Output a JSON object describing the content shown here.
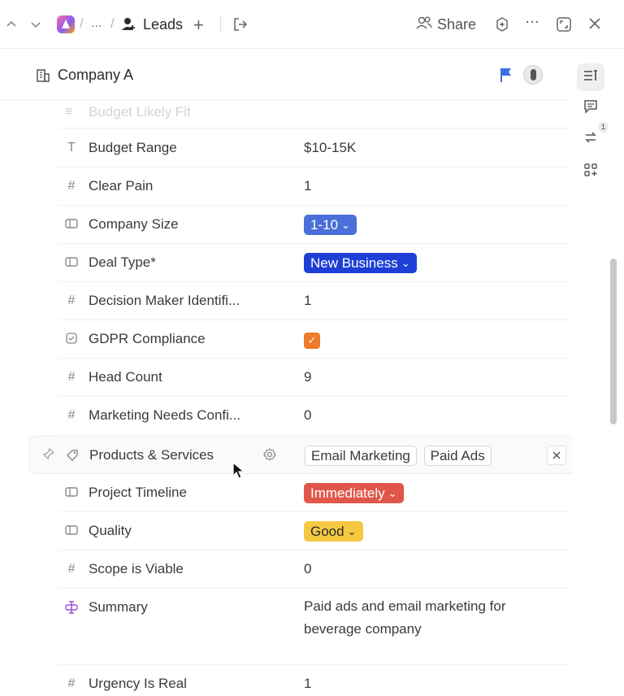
{
  "topbar": {
    "breadcrumb_ellipsis": "...",
    "breadcrumb_sep": "/",
    "list_name": "Leads",
    "share_label": "Share"
  },
  "record": {
    "title": "Company A",
    "flag_color": "#3b6fe0"
  },
  "fields": {
    "faded_above": "Budget Likely Fit",
    "rows": [
      {
        "name": "Budget Range",
        "icon": "text-icon",
        "value": "$10-15K"
      },
      {
        "name": "Clear Pain",
        "icon": "number-icon",
        "value": "1"
      },
      {
        "name": "Company Size",
        "icon": "dropdown-icon",
        "value": "1-10",
        "pill_bg": "#4a6fd8"
      },
      {
        "name": "Deal Type*",
        "icon": "dropdown-icon",
        "value": "New Business",
        "pill_bg": "#1d3fd6"
      },
      {
        "name": "Decision Maker Identifi...",
        "icon": "number-icon",
        "value": "1"
      },
      {
        "name": "GDPR Compliance",
        "icon": "checkbox-icon",
        "value": "checked"
      },
      {
        "name": "Head Count",
        "icon": "number-icon",
        "value": "9"
      },
      {
        "name": "Marketing Needs Confi...",
        "icon": "number-icon",
        "value": "0"
      },
      {
        "name": "Products & Services",
        "icon": "label-icon",
        "tags": [
          "Email Marketing",
          "Paid Ads"
        ]
      },
      {
        "name": "Project Timeline",
        "icon": "dropdown-icon",
        "value": "Immediately",
        "pill_bg": "#e0574a"
      },
      {
        "name": "Quality",
        "icon": "dropdown-icon",
        "value": "Good",
        "pill_bg": "#f5c842"
      },
      {
        "name": "Scope is Viable",
        "icon": "number-icon",
        "value": "0"
      },
      {
        "name": "Summary",
        "icon": "summary-icon",
        "value": "Paid ads and email marketing for beverage company"
      },
      {
        "name": "Urgency Is Real",
        "icon": "number-icon",
        "value": "1"
      }
    ]
  },
  "rail": {
    "activity_badge": "1"
  },
  "glyphs": {
    "text": "T",
    "number": "#",
    "check": "✓",
    "chevron": "⌄",
    "close": "✕",
    "plus": "+",
    "more": "···"
  }
}
